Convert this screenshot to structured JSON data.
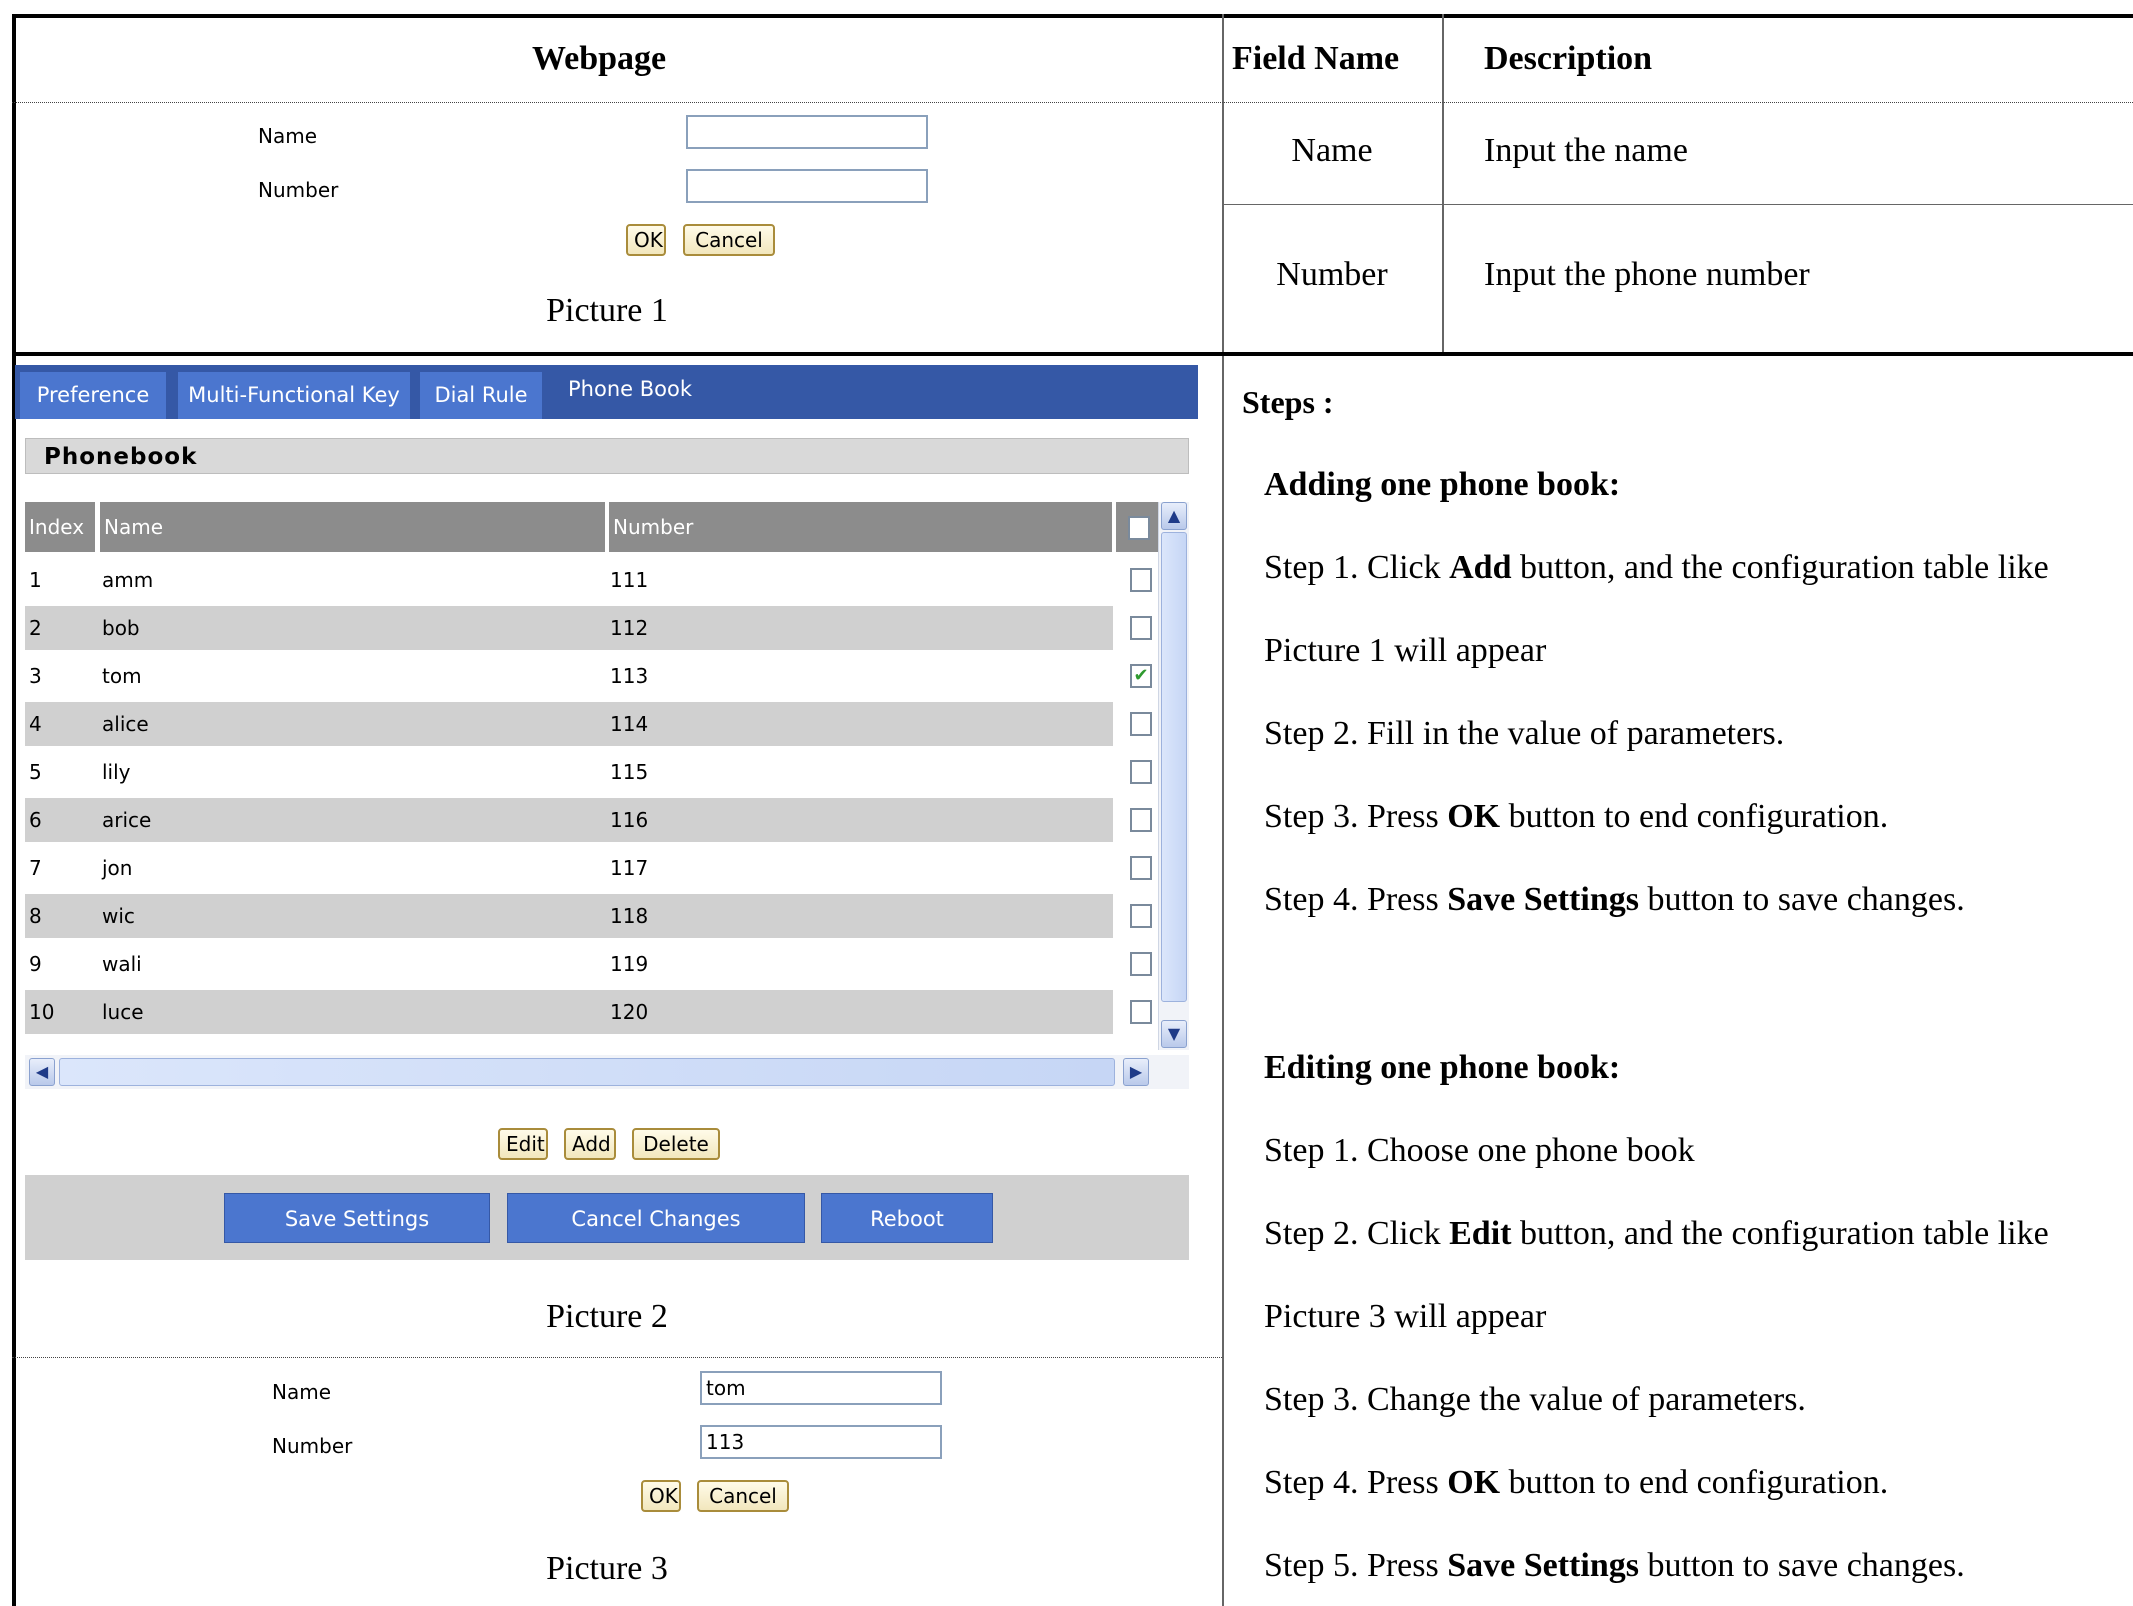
{
  "header": {
    "webpage": "Webpage",
    "field_name": "Field Name",
    "description": "Description"
  },
  "fields_table": [
    {
      "name": "Name",
      "description": "Input the name"
    },
    {
      "name": "Number",
      "description": "Input the phone number"
    }
  ],
  "picture1": {
    "name_label": "Name",
    "number_label": "Number",
    "name_value": "",
    "number_value": "",
    "ok": "OK",
    "cancel": "Cancel",
    "caption": "Picture 1"
  },
  "picture2": {
    "tabs": [
      "Preference",
      "Multi-Functional Key",
      "Dial Rule",
      "Phone Book"
    ],
    "section_title": "Phonebook",
    "columns": {
      "index": "Index",
      "name": "Name",
      "number": "Number"
    },
    "rows": [
      {
        "index": "1",
        "name": "amm",
        "number": "111",
        "checked": false
      },
      {
        "index": "2",
        "name": "bob",
        "number": "112",
        "checked": false
      },
      {
        "index": "3",
        "name": "tom",
        "number": "113",
        "checked": true
      },
      {
        "index": "4",
        "name": "alice",
        "number": "114",
        "checked": false
      },
      {
        "index": "5",
        "name": "lily",
        "number": "115",
        "checked": false
      },
      {
        "index": "6",
        "name": "arice",
        "number": "116",
        "checked": false
      },
      {
        "index": "7",
        "name": "jon",
        "number": "117",
        "checked": false
      },
      {
        "index": "8",
        "name": "wic",
        "number": "118",
        "checked": false
      },
      {
        "index": "9",
        "name": "wali",
        "number": "119",
        "checked": false
      },
      {
        "index": "10",
        "name": "luce",
        "number": "120",
        "checked": false
      }
    ],
    "edit": "Edit",
    "add": "Add",
    "delete": "Delete",
    "save_settings": "Save Settings",
    "cancel_changes": "Cancel Changes",
    "reboot": "Reboot",
    "caption": "Picture 2"
  },
  "picture3": {
    "name_label": "Name",
    "number_label": "Number",
    "name_value": "tom",
    "number_value": "113",
    "ok": "OK",
    "cancel": "Cancel",
    "caption": "Picture 3"
  },
  "steps": {
    "title": "Steps :",
    "adding_title": "Adding one phone book:",
    "adding": [
      {
        "pre": "Step 1. Click ",
        "bold": "Add",
        "post": " button, and the configuration table like"
      },
      {
        "pre": "Picture 1 will appear",
        "bold": "",
        "post": ""
      },
      {
        "pre": "Step 2. Fill in the value of parameters.",
        "bold": "",
        "post": ""
      },
      {
        "pre": "Step 3. Press ",
        "bold": "OK",
        "post": " button to end configuration."
      },
      {
        "pre": "Step 4. Press ",
        "bold": "Save Settings",
        "post": " button to save changes."
      }
    ],
    "editing_title": "Editing one phone book:",
    "editing": [
      {
        "pre": "Step 1. Choose one phone book",
        "bold": "",
        "post": ""
      },
      {
        "pre": "Step 2. Click ",
        "bold": "Edit",
        "post": " button, and the configuration table like"
      },
      {
        "pre": "Picture 3 will appear",
        "bold": "",
        "post": ""
      },
      {
        "pre": "Step 3. Change the value of parameters.",
        "bold": "",
        "post": ""
      },
      {
        "pre": "Step 4. Press ",
        "bold": "OK",
        "post": " button to end configuration."
      },
      {
        "pre": "Step 5. Press ",
        "bold": "Save Settings",
        "post": " button to save changes."
      }
    ]
  }
}
